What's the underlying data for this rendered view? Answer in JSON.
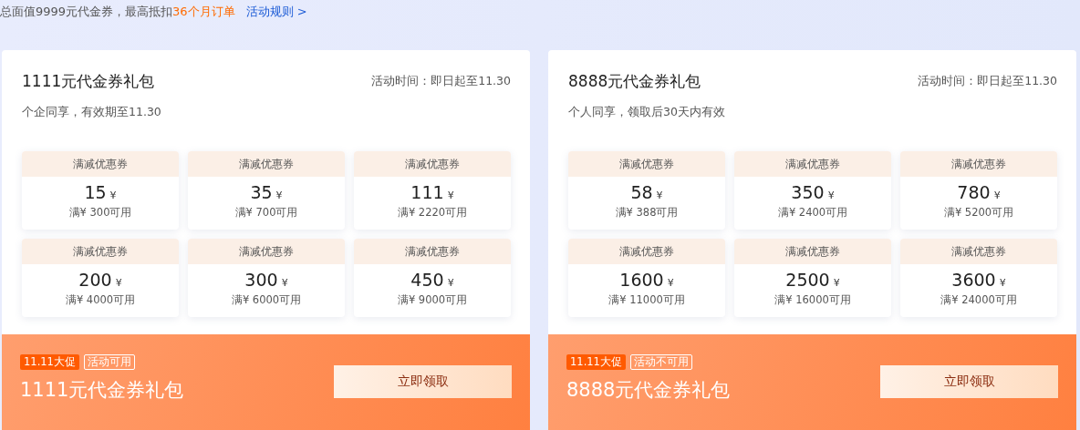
{
  "intro": {
    "text": "总面值9999元代金券，最高抵扣",
    "highlight": "36个月订单",
    "link": "活动规则 >"
  },
  "packages": [
    {
      "title": "1111元代金券礼包",
      "period": "活动时间：即日起至11.30",
      "note": "个企同享，有效期至11.30",
      "coupons": [
        {
          "type": "满减优惠券",
          "amount": "15",
          "currency": "¥",
          "condition": "满¥ 300可用"
        },
        {
          "type": "满减优惠券",
          "amount": "35",
          "currency": "¥",
          "condition": "满¥ 700可用"
        },
        {
          "type": "满减优惠券",
          "amount": "111",
          "currency": "¥",
          "condition": "满¥ 2220可用"
        },
        {
          "type": "满减优惠券",
          "amount": "200",
          "currency": "¥",
          "condition": "满¥ 4000可用"
        },
        {
          "type": "满减优惠券",
          "amount": "300",
          "currency": "¥",
          "condition": "满¥ 6000可用"
        },
        {
          "type": "满减优惠券",
          "amount": "450",
          "currency": "¥",
          "condition": "满¥ 9000可用"
        }
      ],
      "footer": {
        "promo_badge": "11.11大促",
        "status_tag": "活动可用",
        "name": "1111元代金券礼包",
        "button": "立即领取"
      }
    },
    {
      "title": "8888元代金券礼包",
      "period": "活动时间：即日起至11.30",
      "note": "个人同享，领取后30天内有效",
      "coupons": [
        {
          "type": "满减优惠券",
          "amount": "58",
          "currency": "¥",
          "condition": "满¥ 388可用"
        },
        {
          "type": "满减优惠券",
          "amount": "350",
          "currency": "¥",
          "condition": "满¥ 2400可用"
        },
        {
          "type": "满减优惠券",
          "amount": "780",
          "currency": "¥",
          "condition": "满¥ 5200可用"
        },
        {
          "type": "满减优惠券",
          "amount": "1600",
          "currency": "¥",
          "condition": "满¥ 11000可用"
        },
        {
          "type": "满减优惠券",
          "amount": "2500",
          "currency": "¥",
          "condition": "满¥ 16000可用"
        },
        {
          "type": "满减优惠券",
          "amount": "3600",
          "currency": "¥",
          "condition": "满¥ 24000可用"
        }
      ],
      "footer": {
        "promo_badge": "11.11大促",
        "status_tag": "活动不可用",
        "name": "8888元代金券礼包",
        "button": "立即领取"
      }
    }
  ]
}
